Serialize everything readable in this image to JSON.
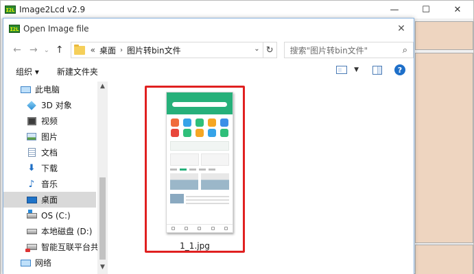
{
  "app": {
    "logo_text": "I2L",
    "title": "Image2Lcd v2.9",
    "controls": {
      "minimize": "—",
      "maximize": "☐",
      "close": "✕"
    }
  },
  "dialog": {
    "logo_text": "I2L",
    "title": "Open Image file",
    "close": "✕"
  },
  "nav": {
    "back": "←",
    "forward": "→",
    "dropdown": "⌄",
    "up": "↑",
    "address": {
      "chevron": "«",
      "segments": [
        "桌面",
        "图片转bin文件"
      ],
      "separator": "›",
      "dropdown": "⌄"
    },
    "refresh": "↻",
    "search_placeholder": "搜索\"图片转bin文件\"",
    "search_icon": "⌕"
  },
  "toolbar": {
    "organize": "组织 ▾",
    "new_folder": "新建文件夹",
    "view_dropdown": "▼",
    "help": "?"
  },
  "sidebar": {
    "items": [
      {
        "label": "此电脑",
        "icon": "computer-icon"
      },
      {
        "label": "3D 对象",
        "icon": "3d-objects-icon"
      },
      {
        "label": "视频",
        "icon": "video-icon"
      },
      {
        "label": "图片",
        "icon": "pictures-icon"
      },
      {
        "label": "文档",
        "icon": "documents-icon"
      },
      {
        "label": "下载",
        "icon": "download-icon"
      },
      {
        "label": "音乐",
        "icon": "music-icon"
      },
      {
        "label": "桌面",
        "icon": "desktop-icon",
        "selected": true
      },
      {
        "label": "OS (C:)",
        "icon": "drive-c-icon"
      },
      {
        "label": "本地磁盘 (D:)",
        "icon": "drive-d-icon"
      },
      {
        "label": "智能互联平台共",
        "icon": "network-drive-icon"
      },
      {
        "label": "网络",
        "icon": "network-icon"
      }
    ],
    "scroll_up": "▲",
    "scroll_down": "▼"
  },
  "files": [
    {
      "name": "1_1.jpg",
      "selected": true
    }
  ],
  "colors": {
    "selection_outline": "#e02020",
    "app_panel": "#eed5c0",
    "thumbnail_header": "#26b07a"
  }
}
